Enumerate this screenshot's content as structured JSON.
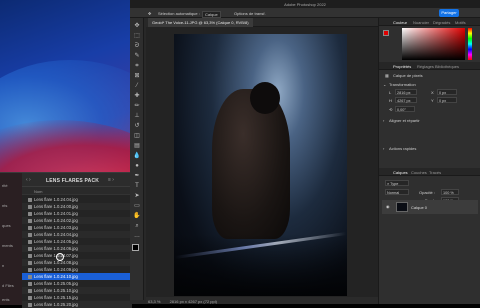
{
  "menubar": {
    "title": "Adobe Photoshop 2022"
  },
  "options_bar": {
    "auto_select_label": "Sélection automatique :",
    "auto_select_value": "Calque",
    "transform_label": "Options de transf.",
    "share_label": "Partager"
  },
  "document_tab": {
    "label": "Geoid* The Voice-11.JPG @ 63,3% (Calque 0, RVB/8)"
  },
  "status_bar": {
    "zoom": "63,3 %",
    "info": "2816 px x 4267 px (72 ppi)"
  },
  "finder": {
    "title": "LENS FLARES PACK",
    "column_header": "Nom",
    "sidebar_items": [
      "rité",
      "nts",
      "ques",
      "ments",
      "n",
      "d Files",
      "ents"
    ],
    "files": [
      "Lens flare 1.0.24.04.jpg",
      "Lens flare 1.0.24.00.jpg",
      "Lens flare 1.0.24.01.jpg",
      "Lens flare 1.0.24.02.jpg",
      "Lens flare 1.0.24.03.jpg",
      "Lens flare 1.0.24.04.jpg",
      "Lens flare 1.0.24.05.jpg",
      "Lens flare 1.0.24.06.jpg",
      "Lens flare 1.0.24.07.jpg",
      "Lens flare 1.0.24.08.jpg",
      "Lens flare 1.0.24.09.jpg",
      "Lens flare 1.0.24.10.jpg",
      "Lens flare 1.0.25.05.jpg",
      "Lens flare 1.0.25.10.jpg",
      "Lens flare 1.0.25.15.jpg",
      "Lens flare 1.0.25.20.jpg"
    ],
    "selected_index": 11
  },
  "color_panel": {
    "tabs": [
      "Couleur",
      "Nuancier",
      "Dégradés",
      "Motifs"
    ],
    "fg_color": "#e00000",
    "bg_color": "#ffffff"
  },
  "properties_panel": {
    "tabs": [
      "Propriétés",
      "Réglages",
      "Bibliothèques"
    ],
    "layer_type": "Calque de pixels",
    "section_transform": "Transformation",
    "w_label": "L",
    "w_value": "2816 px",
    "h_label": "H",
    "h_value": "4267 px",
    "x_label": "X",
    "x_value": "0 px",
    "y_label": "Y",
    "y_value": "0 px",
    "angle_value": "0,00°",
    "section_align": "Aligner et répartir",
    "section_quick": "Actions rapides"
  },
  "layers_panel": {
    "tabs": [
      "Calques",
      "Couches",
      "Tracés"
    ],
    "blend_mode": "Normal",
    "opacity_label": "Opacité :",
    "opacity_value": "100 %",
    "fill_label": "Fond :",
    "fill_value": "100 %",
    "layer_name": "Calque 0"
  }
}
